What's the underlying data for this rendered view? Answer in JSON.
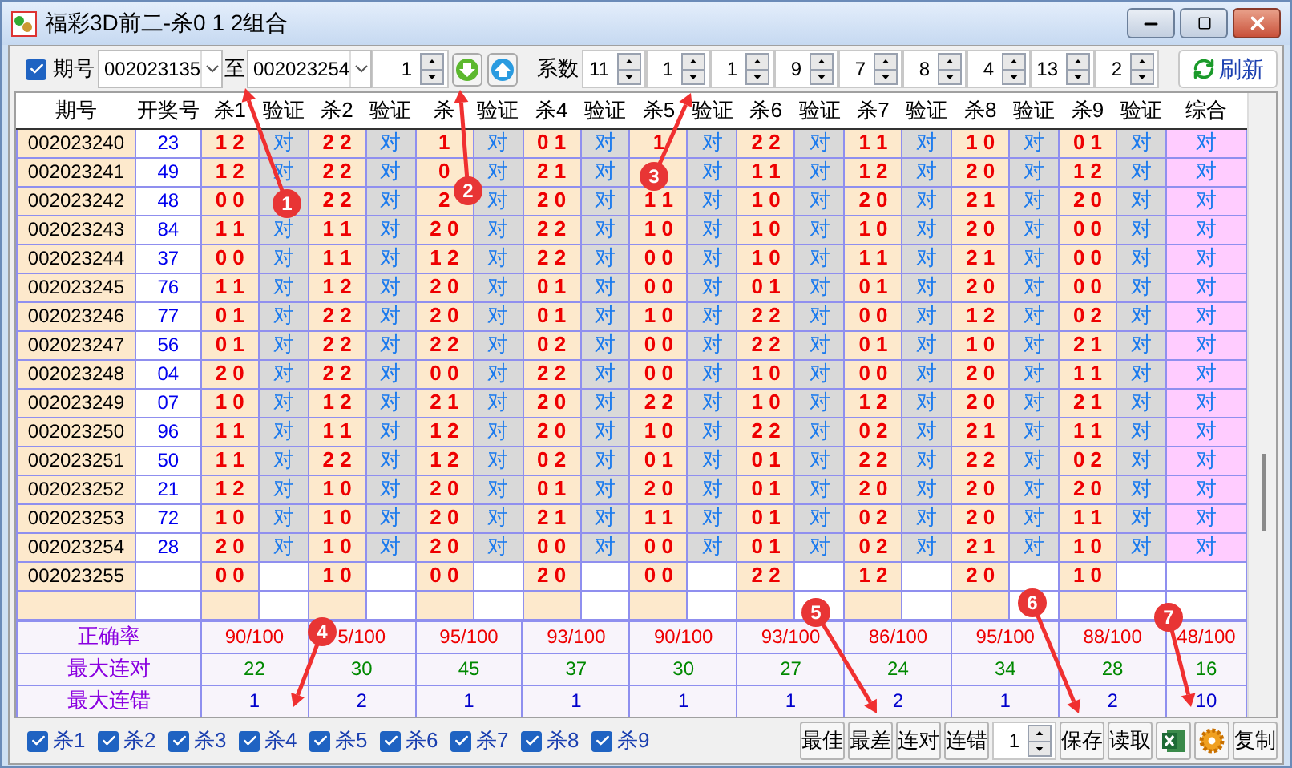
{
  "window": {
    "title": "福彩3D前二-杀0 1 2组合"
  },
  "toolbar": {
    "period_check": {
      "label": "期号",
      "checked": true
    },
    "from": "002023135",
    "to_label": "至",
    "to": "002023254",
    "step": "1",
    "coef_label": "系数",
    "coefs": [
      "11",
      "1",
      "1",
      "9",
      "7",
      "8",
      "4",
      "13",
      "2"
    ],
    "refresh": "刷新"
  },
  "table": {
    "columns": [
      "期号",
      "开奖号",
      "杀1",
      "验证",
      "杀2",
      "验证",
      "杀",
      "验证",
      "杀4",
      "验证",
      "杀5",
      "验证",
      "杀6",
      "验证",
      "杀7",
      "验证",
      "杀8",
      "验证",
      "杀9",
      "验证",
      "综合"
    ],
    "rows": [
      {
        "period": "002023240",
        "number": "23",
        "kills": [
          "1 2",
          "2 2",
          "1",
          "0 1",
          "1",
          "2 2",
          "1 1",
          "1 0",
          "0 1"
        ],
        "verify": [
          "对",
          "对",
          "对",
          "对",
          "对",
          "对",
          "对",
          "对",
          "对"
        ],
        "overall": "对"
      },
      {
        "period": "002023241",
        "number": "49",
        "kills": [
          "1 2",
          "2 2",
          "0",
          "2 1",
          {
            "hidden": true
          },
          "1 1",
          "1 2",
          "2 0",
          "1 2"
        ],
        "verify": [
          "对",
          "对",
          "对",
          "对",
          "对",
          "对",
          "对",
          "对",
          "对"
        ],
        "overall": "对"
      },
      {
        "period": "002023242",
        "number": "48",
        "kills": [
          "0 0",
          "2 2",
          "2",
          "2 0",
          "1 1",
          "1 0",
          "2 0",
          "2 1",
          "2 0"
        ],
        "verify": [
          {
            "hidden": true
          },
          "对",
          "对",
          "对",
          "对",
          "对",
          "对",
          "对",
          "对"
        ],
        "overall": "对"
      },
      {
        "period": "002023243",
        "number": "84",
        "kills": [
          "1 1",
          "1 1",
          "2 0",
          "2 2",
          "1 0",
          "1 0",
          "1 0",
          "2 0",
          "0 0"
        ],
        "verify": [
          "对",
          "对",
          "对",
          "对",
          "对",
          "对",
          "对",
          "对",
          "对"
        ],
        "overall": "对"
      },
      {
        "period": "002023244",
        "number": "37",
        "kills": [
          "0 0",
          "1 1",
          "1 2",
          "2 2",
          "0 0",
          "1 0",
          "1 1",
          "2 1",
          "0 0"
        ],
        "verify": [
          "对",
          "对",
          "对",
          "对",
          "对",
          "对",
          "对",
          "对",
          "对"
        ],
        "overall": "对"
      },
      {
        "period": "002023245",
        "number": "76",
        "kills": [
          "1 1",
          "1 2",
          "2 0",
          "0 1",
          "0 0",
          "0 1",
          "0 1",
          "2 0",
          "0 0"
        ],
        "verify": [
          "对",
          "对",
          "对",
          "对",
          "对",
          "对",
          "对",
          "对",
          "对"
        ],
        "overall": "对"
      },
      {
        "period": "002023246",
        "number": "77",
        "kills": [
          "0 1",
          "2 2",
          "2 0",
          "0 1",
          "1 0",
          "2 2",
          "0 0",
          "1 2",
          "0 2"
        ],
        "verify": [
          "对",
          "对",
          "对",
          "对",
          "对",
          "对",
          "对",
          "对",
          "对"
        ],
        "overall": "对"
      },
      {
        "period": "002023247",
        "number": "56",
        "kills": [
          "0 1",
          "2 2",
          "2 2",
          "0 2",
          "0 0",
          "2 2",
          "0 1",
          "1 0",
          "2 1"
        ],
        "verify": [
          "对",
          "对",
          "对",
          "对",
          "对",
          "对",
          "对",
          "对",
          "对"
        ],
        "overall": "对"
      },
      {
        "period": "002023248",
        "number": "04",
        "kills": [
          "2 0",
          "2 2",
          "0 0",
          "2 2",
          "0 0",
          "1 0",
          "0 0",
          "2 0",
          "1 1"
        ],
        "verify": [
          "对",
          "对",
          "对",
          "对",
          "对",
          "对",
          "对",
          "对",
          "对"
        ],
        "overall": "对"
      },
      {
        "period": "002023249",
        "number": "07",
        "kills": [
          "1 0",
          "1 2",
          "2 1",
          "2 0",
          "2 2",
          "1 0",
          "1 2",
          "2 0",
          "2 1"
        ],
        "verify": [
          "对",
          "对",
          "对",
          "对",
          "对",
          "对",
          "对",
          "对",
          "对"
        ],
        "overall": "对"
      },
      {
        "period": "002023250",
        "number": "96",
        "kills": [
          "1 1",
          "1 1",
          "1 2",
          "2 0",
          "1 0",
          "2 2",
          "0 2",
          "2 1",
          "1 1"
        ],
        "verify": [
          "对",
          "对",
          "对",
          "对",
          "对",
          "对",
          "对",
          "对",
          "对"
        ],
        "overall": "对"
      },
      {
        "period": "002023251",
        "number": "50",
        "kills": [
          "1 1",
          "2 2",
          "1 2",
          "0 2",
          "0 1",
          "0 1",
          "2 2",
          "2 2",
          "0 2"
        ],
        "verify": [
          "对",
          "对",
          "对",
          "对",
          "对",
          "对",
          "对",
          "对",
          "对"
        ],
        "overall": "对"
      },
      {
        "period": "002023252",
        "number": "21",
        "kills": [
          "1 2",
          "1 0",
          "2 0",
          "0 1",
          "2 0",
          "0 1",
          "2 0",
          "2 0",
          "2 0"
        ],
        "verify": [
          "对",
          "对",
          "对",
          "对",
          "对",
          "对",
          "对",
          "对",
          "对"
        ],
        "overall": "对"
      },
      {
        "period": "002023253",
        "number": "72",
        "kills": [
          "1 0",
          "1 0",
          "2 0",
          "2 1",
          "1 1",
          "0 1",
          "0 2",
          "2 0",
          "1 1"
        ],
        "verify": [
          "对",
          "对",
          "对",
          "对",
          "对",
          "对",
          "对",
          "对",
          "对"
        ],
        "overall": "对"
      },
      {
        "period": "002023254",
        "number": "28",
        "kills": [
          "2 0",
          "1 0",
          "2 0",
          "0 0",
          "0 0",
          "0 1",
          "0 2",
          "2 1",
          "1 0"
        ],
        "verify": [
          "对",
          "对",
          "对",
          "对",
          "对",
          "对",
          "对",
          "对",
          "对"
        ],
        "overall": "对"
      },
      {
        "period": "002023255",
        "kills": [
          "0 0",
          "1 0",
          "0 0",
          "2 0",
          "0 0",
          "2 2",
          "1 2",
          "2 0",
          "1 0"
        ]
      }
    ]
  },
  "stats": [
    {
      "label": "正确率",
      "kind": "rate",
      "values": [
        "90/100",
        "5/100",
        "95/100",
        "93/100",
        "90/100",
        "93/100",
        "86/100",
        "95/100",
        "88/100",
        "48/100"
      ]
    },
    {
      "label": "最大连对",
      "kind": "hits",
      "values": [
        "22",
        "30",
        "45",
        "37",
        "30",
        "27",
        "24",
        "34",
        "28",
        "16"
      ]
    },
    {
      "label": "最大连错",
      "kind": "misses",
      "values": [
        "1",
        "2",
        "1",
        "1",
        "1",
        "1",
        "2",
        "1",
        "2",
        "10"
      ]
    }
  ],
  "bottom": {
    "checks": [
      {
        "label": "杀1",
        "checked": true
      },
      {
        "label": "杀2",
        "checked": true
      },
      {
        "label": "杀3",
        "checked": true
      },
      {
        "label": "杀4",
        "checked": true
      },
      {
        "label": "杀5",
        "checked": true
      },
      {
        "label": "杀6",
        "checked": true
      },
      {
        "label": "杀7",
        "checked": true
      },
      {
        "label": "杀8",
        "checked": true
      },
      {
        "label": "杀9",
        "checked": true
      }
    ],
    "buttons_left": [
      "最佳",
      "最差",
      "连对",
      "连错"
    ],
    "step": "1",
    "buttons_right": [
      "保存",
      "读取"
    ],
    "copy": "复制"
  },
  "annotations": [
    "1",
    "2",
    "3",
    "4",
    "5",
    "6",
    "7"
  ]
}
